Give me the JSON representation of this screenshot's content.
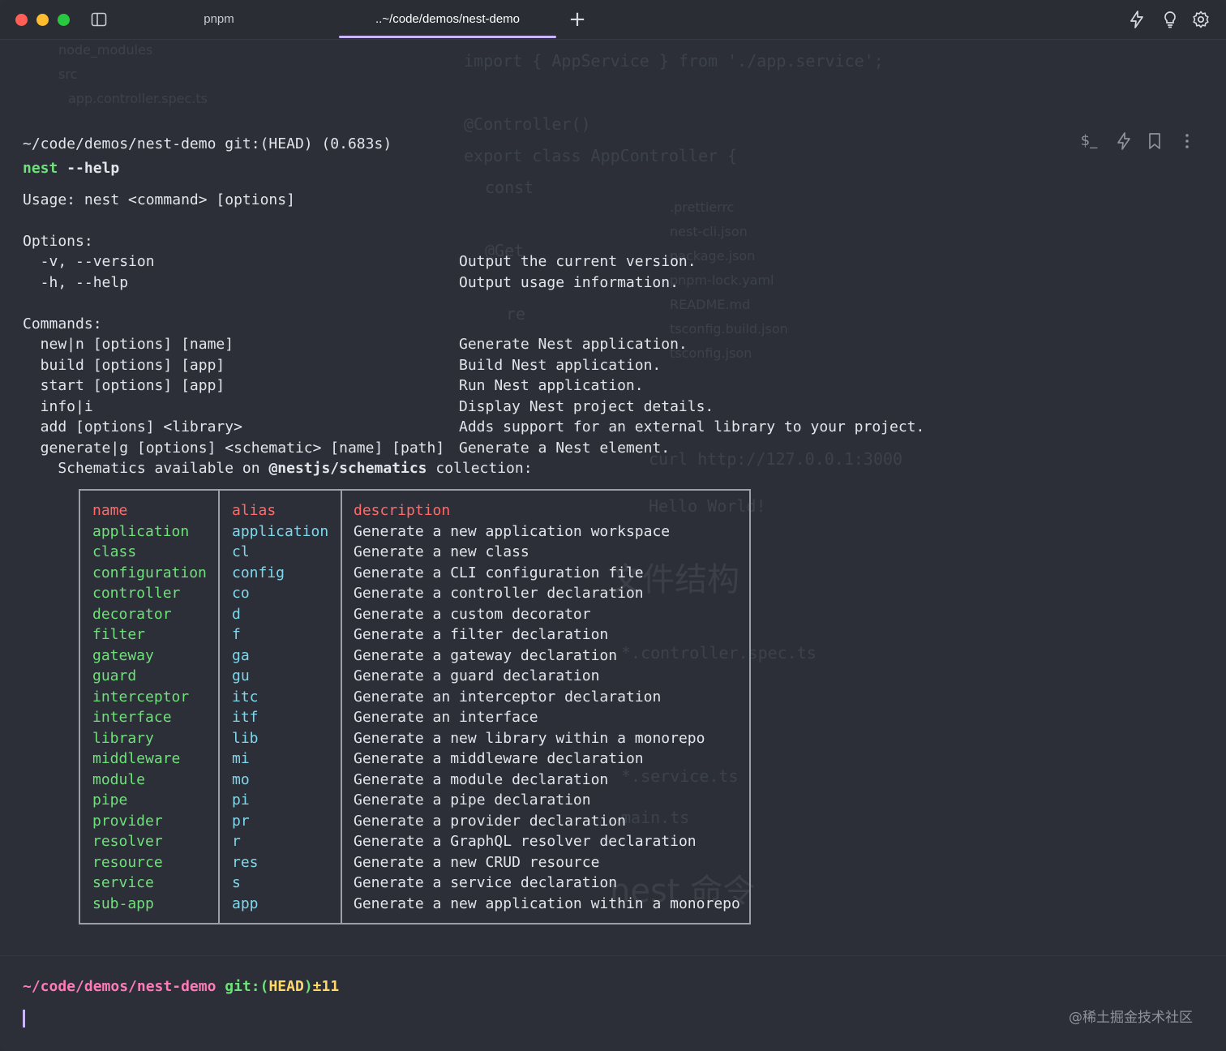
{
  "tabs": [
    {
      "label": "pnpm",
      "active": false
    },
    {
      "label": "..~/code/demos/nest-demo",
      "active": true
    }
  ],
  "toolbar_icons": [
    "lightning-icon",
    "lightbulb-icon",
    "gear-icon"
  ],
  "block_icons": [
    "dollar-prompt-icon",
    "lightning-icon",
    "bookmark-icon",
    "more-vertical-icon"
  ],
  "block": {
    "header": "~/code/demos/nest-demo git:(HEAD) (0.683s)",
    "command_name": "nest",
    "command_args": " --help",
    "usage": "Usage: nest <command> [options]",
    "options_title": "Options:",
    "options": [
      {
        "flag": "  -v, --version",
        "desc": "Output the current version."
      },
      {
        "flag": "  -h, --help",
        "desc": "Output usage information."
      }
    ],
    "commands_title": "Commands:",
    "commands": [
      {
        "cmd": "  new|n [options] [name]",
        "desc": "Generate Nest application."
      },
      {
        "cmd": "  build [options] [app]",
        "desc": "Build Nest application."
      },
      {
        "cmd": "  start [options] [app]",
        "desc": "Run Nest application."
      },
      {
        "cmd": "  info|i",
        "desc": "Display Nest project details."
      },
      {
        "cmd": "  add [options] <library>",
        "desc": "Adds support for an external library to your project."
      },
      {
        "cmd": "  generate|g [options] <schematic> [name] [path]",
        "desc": "Generate a Nest element."
      }
    ],
    "schematics_prefix": "    Schematics available on ",
    "schematics_pkg": "@nestjs/schematics",
    "schematics_suffix": " collection:"
  },
  "schematics_table": {
    "headers": [
      "name",
      "alias",
      "description"
    ],
    "rows": [
      [
        "application",
        "application",
        "Generate a new application workspace"
      ],
      [
        "class",
        "cl",
        "Generate a new class"
      ],
      [
        "configuration",
        "config",
        "Generate a CLI configuration file"
      ],
      [
        "controller",
        "co",
        "Generate a controller declaration"
      ],
      [
        "decorator",
        "d",
        "Generate a custom decorator"
      ],
      [
        "filter",
        "f",
        "Generate a filter declaration"
      ],
      [
        "gateway",
        "ga",
        "Generate a gateway declaration"
      ],
      [
        "guard",
        "gu",
        "Generate a guard declaration"
      ],
      [
        "interceptor",
        "itc",
        "Generate an interceptor declaration"
      ],
      [
        "interface",
        "itf",
        "Generate an interface"
      ],
      [
        "library",
        "lib",
        "Generate a new library within a monorepo"
      ],
      [
        "middleware",
        "mi",
        "Generate a middleware declaration"
      ],
      [
        "module",
        "mo",
        "Generate a module declaration"
      ],
      [
        "pipe",
        "pi",
        "Generate a pipe declaration"
      ],
      [
        "provider",
        "pr",
        "Generate a provider declaration"
      ],
      [
        "resolver",
        "r",
        "Generate a GraphQL resolver declaration"
      ],
      [
        "resource",
        "res",
        "Generate a new CRUD resource"
      ],
      [
        "service",
        "s",
        "Generate a service declaration"
      ],
      [
        "sub-app",
        "app",
        "Generate a new application within a monorepo"
      ]
    ]
  },
  "prompt": {
    "path": "~/code/demos/nest-demo",
    "git_prefix": " git:(",
    "branch": "HEAD",
    "git_suffix": ")",
    "status": "±11"
  },
  "watermark": "@稀土掘金技术社区",
  "colors": {
    "accent": "#c9b6ff",
    "command": "#6fe07a",
    "alias": "#7fd7ec",
    "header": "#ff6a6a",
    "prompt_path": "#ff7ab8",
    "prompt_branch": "#ffd866"
  }
}
